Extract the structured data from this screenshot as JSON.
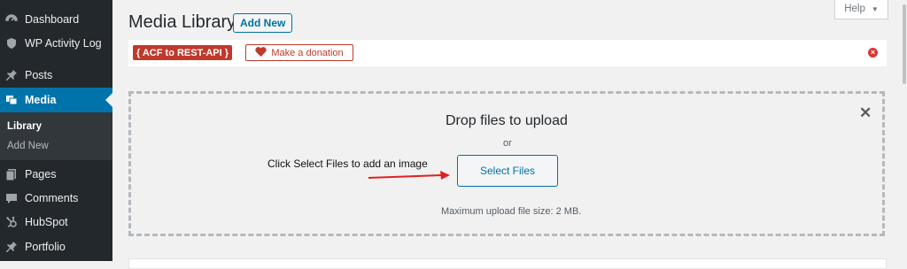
{
  "sidebar": {
    "items": [
      {
        "label": "Dashboard",
        "icon": "dashboard-icon"
      },
      {
        "label": "WP Activity Log",
        "icon": "shield-icon"
      },
      {
        "label": "Posts",
        "icon": "pin-icon"
      },
      {
        "label": "Media",
        "icon": "media-icon"
      },
      {
        "label": "Pages",
        "icon": "pages-icon"
      },
      {
        "label": "Comments",
        "icon": "comment-icon"
      },
      {
        "label": "HubSpot",
        "icon": "hubspot-icon"
      },
      {
        "label": "Portfolio",
        "icon": "pin-icon"
      }
    ],
    "submenu": [
      {
        "label": "Library"
      },
      {
        "label": "Add New"
      }
    ]
  },
  "header": {
    "title": "Media Library",
    "add_new_label": "Add New",
    "help_label": "Help"
  },
  "notice": {
    "acf_label": "{ ACF to REST-API }",
    "donation_label": "Make a donation"
  },
  "uploader": {
    "drop_text": "Drop files to upload",
    "or_text": "or",
    "select_files_label": "Select Files",
    "max_size_text": "Maximum upload file size: 2 MB."
  },
  "annotation": {
    "text": "Click Select Files to add an image"
  },
  "colors": {
    "sidebar_bg": "#23282d",
    "active_bg": "#0073aa",
    "accent": "#0071a1",
    "notice_red": "#c0392b"
  }
}
